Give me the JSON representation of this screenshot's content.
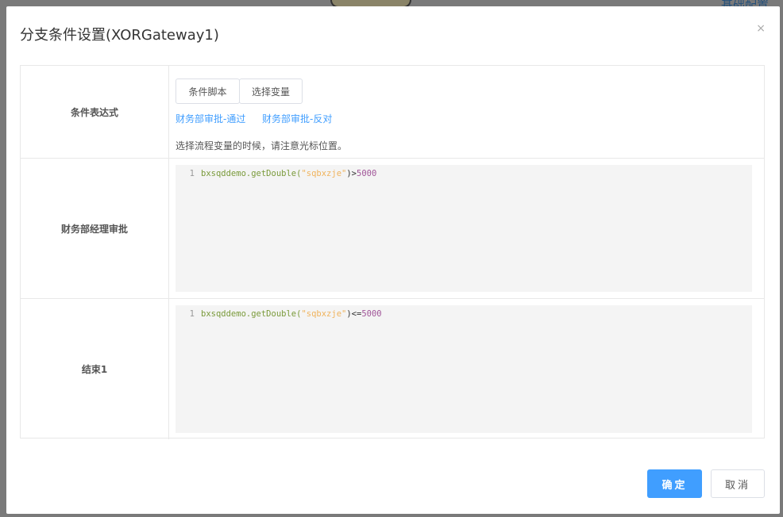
{
  "background": {
    "link": "基础配置"
  },
  "dialog": {
    "title": "分支条件设置(XORGateway1)",
    "close": "×",
    "rows": [
      {
        "label": "条件表达式",
        "buttons": [
          "条件脚本",
          "选择变量"
        ],
        "links": [
          "财务部审批-通过",
          "财务部审批-反对"
        ],
        "hint": "选择流程变量的时候，请注意光标位置。"
      },
      {
        "label": "财务部经理审批",
        "code": {
          "line": "1",
          "object": "bxsqddemo.",
          "method": "getDouble(",
          "arg": "\"sqbxzje\"",
          "close": ")",
          "op": ">",
          "value": "5000"
        }
      },
      {
        "label": "结束1",
        "code": {
          "line": "1",
          "object": "bxsqddemo.",
          "method": "getDouble(",
          "arg": "\"sqbxzje\"",
          "close": ")",
          "op": "<=",
          "value": "5000"
        }
      }
    ],
    "confirm": "确定",
    "cancel": "取消"
  }
}
